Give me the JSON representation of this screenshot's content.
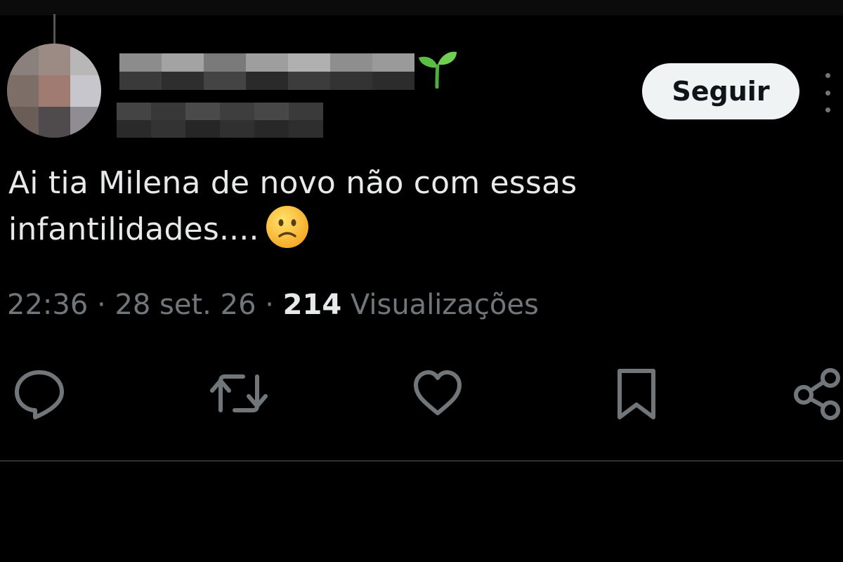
{
  "author": {
    "avatar_icon": "blurred-avatar",
    "name_hidden": true,
    "handle_hidden": true,
    "badge_icon": "seedling-emoji-icon"
  },
  "follow_button": {
    "label": "Seguir"
  },
  "more_icon": "more-vertical-icon",
  "tweet": {
    "line1": "Ai tia Milena de novo não com essas",
    "line2": "infantilidades....",
    "emoji": "slightly-frowning-face-emoji"
  },
  "meta": {
    "time": "22:36",
    "separator1": " · ",
    "date": "28 set. 26",
    "separator2": " · ",
    "views_count": "214",
    "views_label": " Visualizações"
  },
  "actions": [
    {
      "name": "reply",
      "icon": "comment-icon"
    },
    {
      "name": "retweet",
      "icon": "retweet-icon"
    },
    {
      "name": "like",
      "icon": "heart-icon"
    },
    {
      "name": "bookmark",
      "icon": "bookmark-icon"
    },
    {
      "name": "share",
      "icon": "share-icon"
    }
  ],
  "colors": {
    "background": "#000000",
    "text_primary": "#e7e9ea",
    "text_secondary": "#71767b",
    "button_bg": "#eff3f4",
    "button_text": "#0f1419",
    "divider": "#2f3336"
  }
}
